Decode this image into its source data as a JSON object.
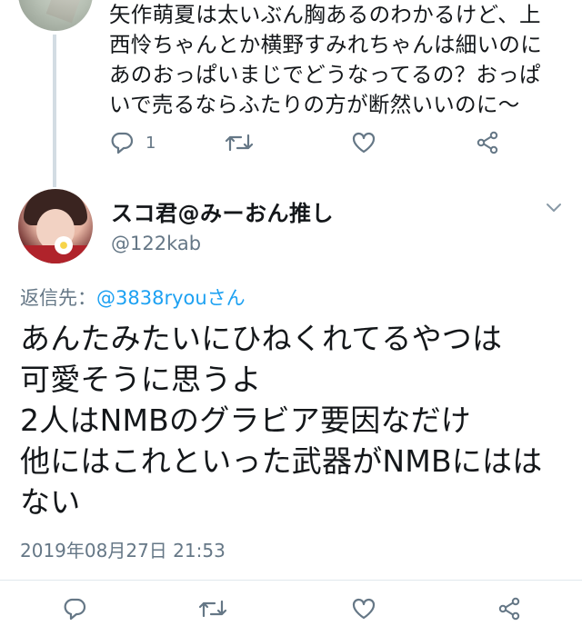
{
  "parent_tweet": {
    "text": "矢作萌夏は太いぶん胸あるのわかるけど、上\n西怜ちゃんとか横野すみれちゃんは細いのに\nあのおっぱいまじでどうなってるの？おっぱ\nいで売るならふたりの方が断然いいのに〜",
    "reply_count": "1"
  },
  "tweet": {
    "display_name": "スコ君@みーおん推し",
    "handle": "@122kab",
    "reply_prefix": "返信先：",
    "reply_mention": "@3838ryouさん",
    "text": "あんたみたいにひねくれてるやつは\n可愛そうに思うよ\n2人はNMBのグラビア要因なだけ\n他にはこれといった武器がNMBにはは\nない",
    "timestamp": "2019年08月27日 21:53"
  },
  "icons": [
    "reply-icon",
    "retweet-icon",
    "like-icon",
    "share-icon",
    "chevron-down-icon"
  ],
  "colors": {
    "text": "#14171a",
    "muted": "#657786",
    "link": "#1da1f2",
    "thread": "#d3dce3"
  }
}
